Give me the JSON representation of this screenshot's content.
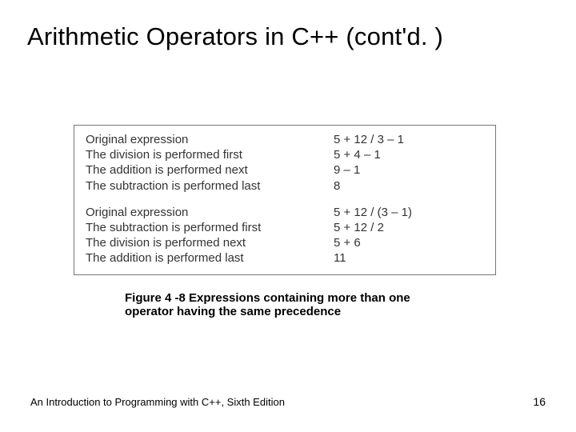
{
  "title": "Arithmetic Operators in C++ (cont'd. )",
  "figure": {
    "block1": {
      "rows": [
        {
          "desc": "Original expression",
          "expr": "5 + 12 / 3 – 1"
        },
        {
          "desc": "The division is performed first",
          "expr": "5 + 4 – 1"
        },
        {
          "desc": "The addition is performed next",
          "expr": "9 – 1"
        },
        {
          "desc": "The subtraction is performed last",
          "expr": "8"
        }
      ]
    },
    "block2": {
      "rows": [
        {
          "desc": "Original expression",
          "expr": "5 + 12 / (3 – 1)"
        },
        {
          "desc": "The subtraction is performed first",
          "expr": "5 + 12 / 2"
        },
        {
          "desc": "The division is performed next",
          "expr": "5 + 6"
        },
        {
          "desc": "The addition is performed last",
          "expr": "11"
        }
      ]
    }
  },
  "caption": "Figure 4 -8 Expressions containing more than one operator having the same precedence",
  "footer": {
    "left": "An Introduction to Programming with C++, Sixth Edition",
    "right": "16"
  }
}
